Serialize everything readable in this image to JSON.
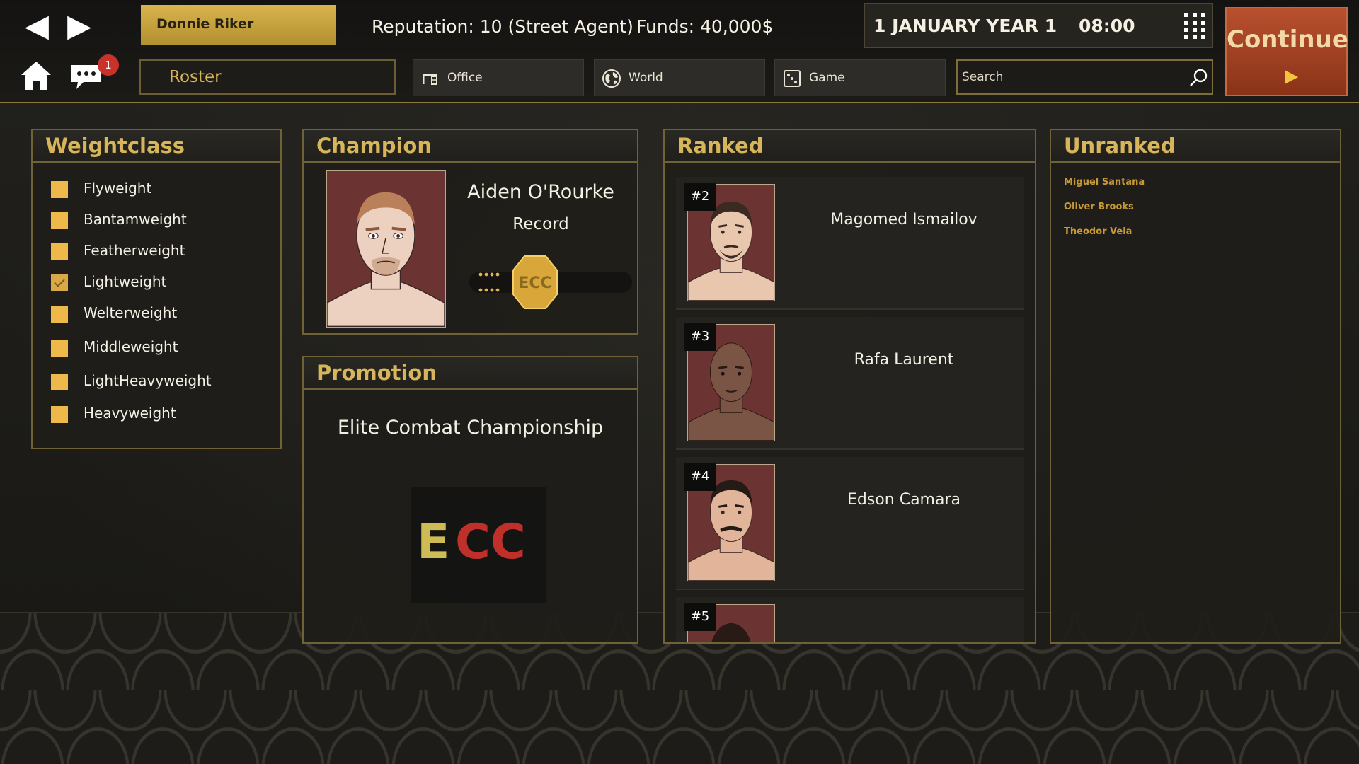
{
  "header": {
    "agent_name": "Donnie Riker",
    "reputation": "Reputation: 10 (Street Agent)",
    "funds": "Funds: 40,000$",
    "date": "1 JANUARY YEAR 1",
    "time": "08:00",
    "continue_label": "Continue",
    "notification_count": "1"
  },
  "nav": {
    "roster_label": "Roster",
    "menu": [
      {
        "label": "Office",
        "icon": "office-icon"
      },
      {
        "label": "World",
        "icon": "globe-icon"
      },
      {
        "label": "Game",
        "icon": "dice-icon"
      }
    ],
    "search_placeholder": "Search"
  },
  "weightclass": {
    "title": "Weightclass",
    "items": [
      {
        "label": "Flyweight",
        "checked": false
      },
      {
        "label": "Bantamweight",
        "checked": false
      },
      {
        "label": "Featherweight",
        "checked": false
      },
      {
        "label": "Lightweight",
        "checked": true
      },
      {
        "label": "Welterweight",
        "checked": false
      },
      {
        "label": "Middleweight",
        "checked": false
      },
      {
        "label": "LightHeavyweight",
        "checked": false
      },
      {
        "label": "Heavyweight",
        "checked": false
      }
    ]
  },
  "champion": {
    "title": "Champion",
    "name": "Aiden O'Rourke",
    "record_label": "Record",
    "belt_text": "ECC"
  },
  "promotion": {
    "title": "Promotion",
    "name": "Elite Combat Championship",
    "logo_e": "E",
    "logo_cc": "CC"
  },
  "ranked": {
    "title": "Ranked",
    "fighters": [
      {
        "rank": "#2",
        "name": "Magomed Ismailov"
      },
      {
        "rank": "#3",
        "name": "Rafa Laurent"
      },
      {
        "rank": "#4",
        "name": "Edson Camara"
      },
      {
        "rank": "#5",
        "name": ""
      }
    ]
  },
  "unranked": {
    "title": "Unranked",
    "fighters": [
      "Miguel Santana",
      "Oliver Brooks",
      "Theodor Vela"
    ]
  },
  "colors": {
    "accent_gold": "#d7b55a",
    "continue_orange": "#b8502e",
    "portrait_bg": "#6b3432",
    "checkbox": "#efb84b"
  }
}
